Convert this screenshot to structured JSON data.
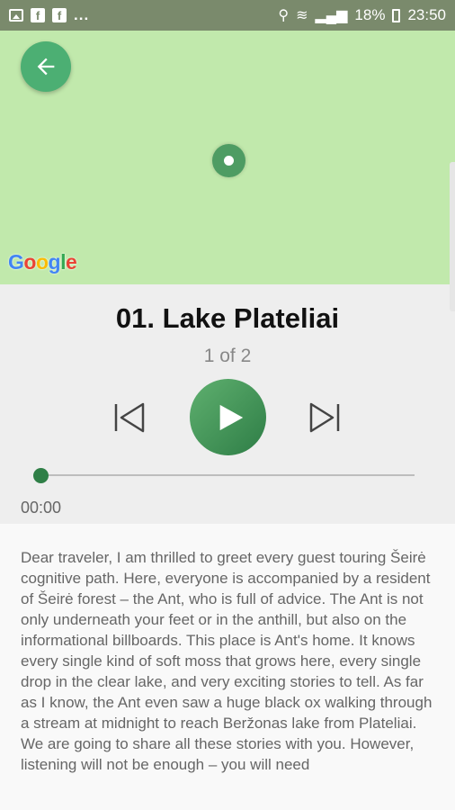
{
  "status_bar": {
    "icons_left": [
      "image-notification-icon",
      "facebook-icon",
      "facebook-icon"
    ],
    "more": "...",
    "battery_percent": "18%",
    "time": "23:50"
  },
  "map": {
    "provider_logo": "Google",
    "logo_colors": [
      "#4285F4",
      "#EA4335",
      "#FBBC05",
      "#4285F4",
      "#34A853",
      "#EA4335"
    ]
  },
  "player": {
    "title": "01. Lake Plateliai",
    "track_count": "1 of 2",
    "elapsed": "00:00",
    "progress": 0
  },
  "colors": {
    "accent": "#2e7d46",
    "map": "#c1e9ac",
    "status_bar": "#7a8a6c"
  },
  "description": "Dear traveler, I am thrilled to greet every guest touring Šeirė cognitive path. Here, everyone is accompanied by a resident of Šeirė forest – the Ant, who is full of advice. The Ant is not only underneath your feet or in the anthill, but also on the informational billboards.  This place is Ant's home. It knows every single kind of soft moss that grows here, every single drop in the clear lake, and very exciting stories to tell. As far as I know, the Ant even saw a huge black ox walking through a stream at midnight to reach Beržonas lake from Plateliai. We are going to share all these stories with you. However, listening will not be enough – you will need"
}
